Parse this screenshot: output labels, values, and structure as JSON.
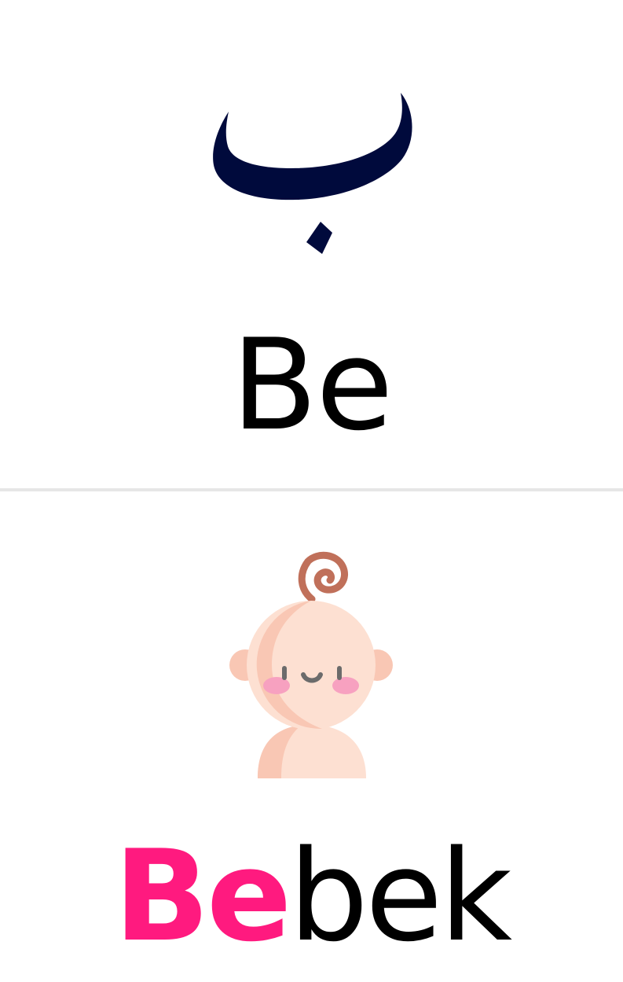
{
  "letter": {
    "arabic": "ب",
    "name": "Be",
    "color": "#000a3c"
  },
  "example": {
    "icon": "baby-icon",
    "word_highlight": "Be",
    "word_rest": "bek",
    "highlight_color": "#ff1a7f"
  },
  "colors": {
    "divider": "#e6e6e6",
    "skin_light": "#fde0d2",
    "skin_dark": "#f9c7b4",
    "cheek": "#f7a1c0",
    "curl": "#c0705a"
  }
}
